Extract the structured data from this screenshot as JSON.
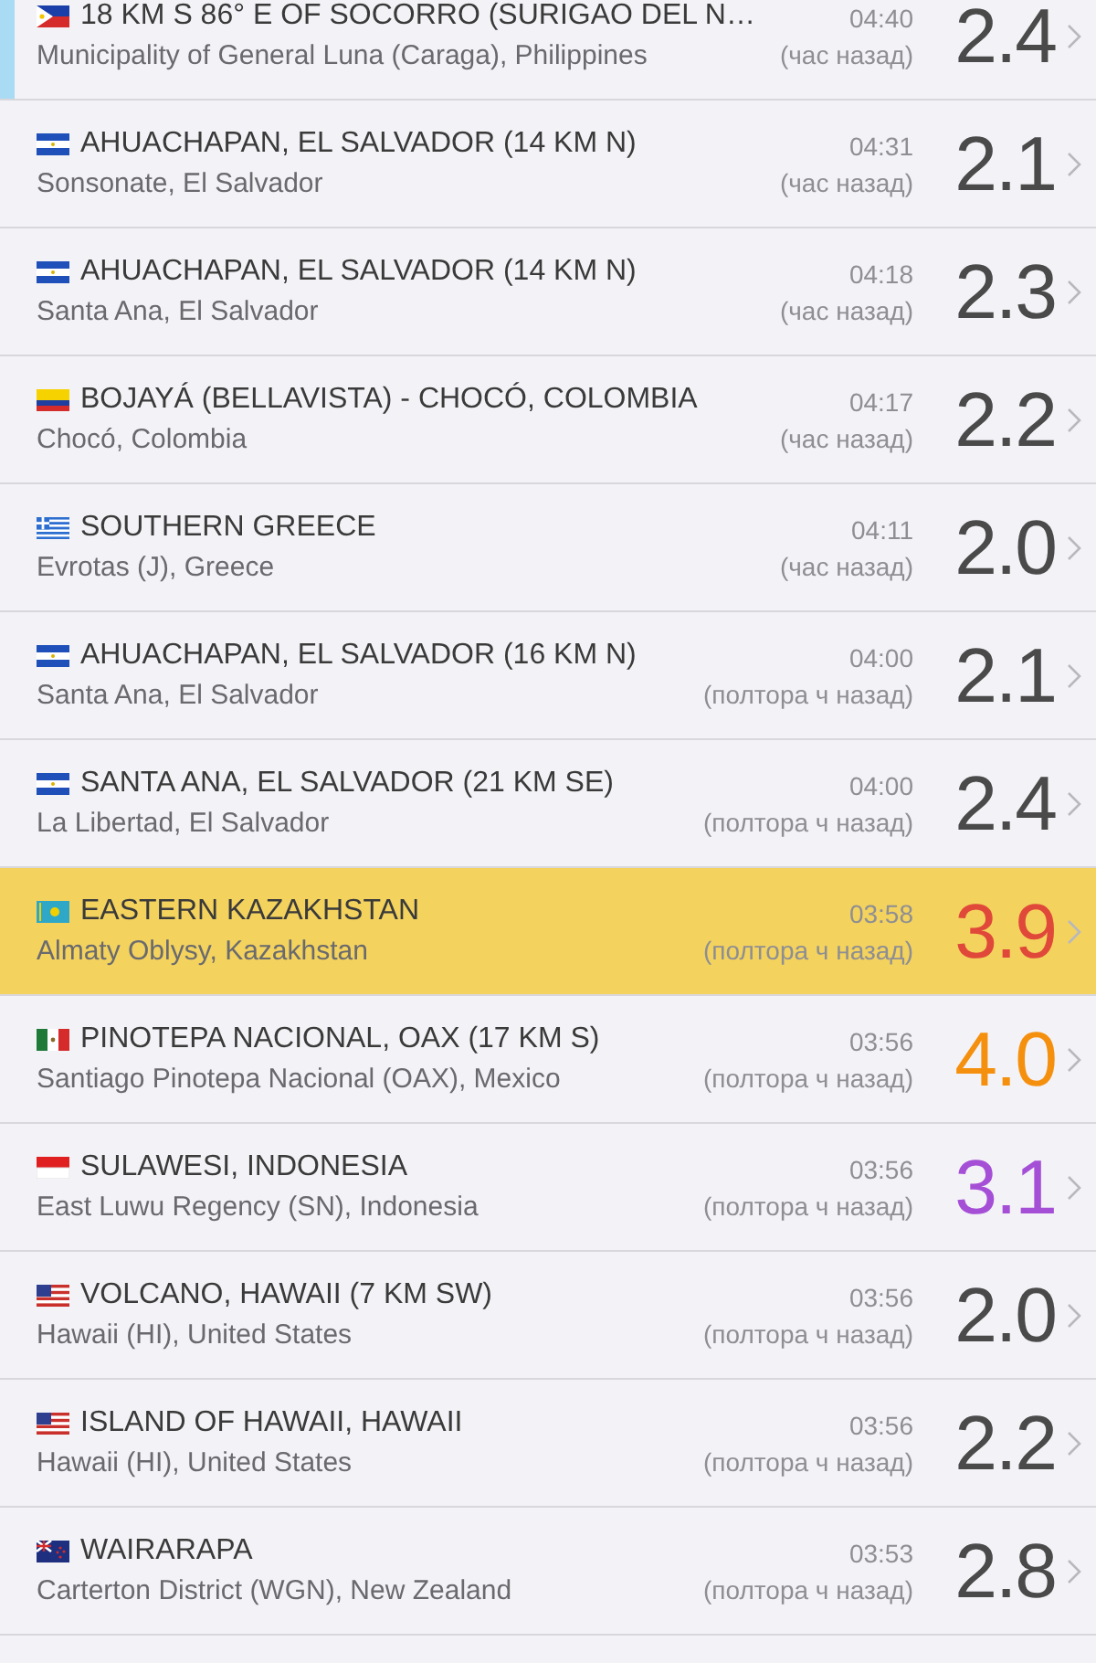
{
  "quakes": [
    {
      "kind": "ph",
      "title": "18 KM S 86° E OF SOCORRO (SURIGAO DEL N…",
      "time": "04:40",
      "place": "Municipality of General Luna (Caraga), Philippines",
      "ago": "(час назад)",
      "magnitude": "2.4",
      "color": "#4a4a4a",
      "selected": true,
      "highlighted": false
    },
    {
      "kind": "sv",
      "title": "AHUACHAPAN, EL SALVADOR (14 KM N)",
      "time": "04:31",
      "place": "Sonsonate, El Salvador",
      "ago": "(час назад)",
      "magnitude": "2.1",
      "color": "#4a4a4a",
      "selected": false,
      "highlighted": false
    },
    {
      "kind": "sv",
      "title": "AHUACHAPAN, EL SALVADOR (14 KM N)",
      "time": "04:18",
      "place": "Santa Ana, El Salvador",
      "ago": "(час назад)",
      "magnitude": "2.3",
      "color": "#4a4a4a",
      "selected": false,
      "highlighted": false
    },
    {
      "kind": "co",
      "title": "BOJAYÁ (BELLAVISTA) - CHOCÓ, COLOMBIA",
      "time": "04:17",
      "place": "Chocó, Colombia",
      "ago": "(час назад)",
      "magnitude": "2.2",
      "color": "#4a4a4a",
      "selected": false,
      "highlighted": false
    },
    {
      "kind": "gr",
      "title": "SOUTHERN GREECE",
      "time": "04:11",
      "place": "Evrotas (J), Greece",
      "ago": "(час назад)",
      "magnitude": "2.0",
      "color": "#4a4a4a",
      "selected": false,
      "highlighted": false
    },
    {
      "kind": "sv",
      "title": "AHUACHAPAN, EL SALVADOR (16 KM N)",
      "time": "04:00",
      "place": "Santa Ana, El Salvador",
      "ago": "(полтора ч назад)",
      "magnitude": "2.1",
      "color": "#4a4a4a",
      "selected": false,
      "highlighted": false
    },
    {
      "kind": "sv",
      "title": "SANTA ANA, EL SALVADOR (21 KM SE)",
      "time": "04:00",
      "place": "La Libertad, El Salvador",
      "ago": "(полтора ч назад)",
      "magnitude": "2.4",
      "color": "#4a4a4a",
      "selected": false,
      "highlighted": false
    },
    {
      "kind": "kz",
      "title": "EASTERN KAZAKHSTAN",
      "time": "03:58",
      "place": "Almaty Oblysy, Kazakhstan",
      "ago": "(полтора ч назад)",
      "magnitude": "3.9",
      "color": "#e0483a",
      "selected": false,
      "highlighted": true
    },
    {
      "kind": "mx",
      "title": "PINOTEPA NACIONAL, OAX (17 KM S)",
      "time": "03:56",
      "place": "Santiago Pinotepa Nacional (OAX), Mexico",
      "ago": "(полтора ч назад)",
      "magnitude": "4.0",
      "color": "#f5900f",
      "selected": false,
      "highlighted": false
    },
    {
      "kind": "id",
      "title": "SULAWESI, INDONESIA",
      "time": "03:56",
      "place": "East Luwu Regency (SN), Indonesia",
      "ago": "(полтора ч назад)",
      "magnitude": "3.1",
      "color": "#a54fd6",
      "selected": false,
      "highlighted": false
    },
    {
      "kind": "us",
      "title": "VOLCANO, HAWAII (7 KM SW)",
      "time": "03:56",
      "place": "Hawaii (HI), United States",
      "ago": "(полтора ч назад)",
      "magnitude": "2.0",
      "color": "#4a4a4a",
      "selected": false,
      "highlighted": false
    },
    {
      "kind": "us",
      "title": "ISLAND OF HAWAII, HAWAII",
      "time": "03:56",
      "place": "Hawaii (HI), United States",
      "ago": "(полтора ч назад)",
      "magnitude": "2.2",
      "color": "#4a4a4a",
      "selected": false,
      "highlighted": false
    },
    {
      "kind": "nz",
      "title": "WAIRARAPA",
      "time": "03:53",
      "place": "Carterton District (WGN), New Zealand",
      "ago": "(полтора ч назад)",
      "magnitude": "2.8",
      "color": "#4a4a4a",
      "selected": false,
      "highlighted": false
    }
  ]
}
